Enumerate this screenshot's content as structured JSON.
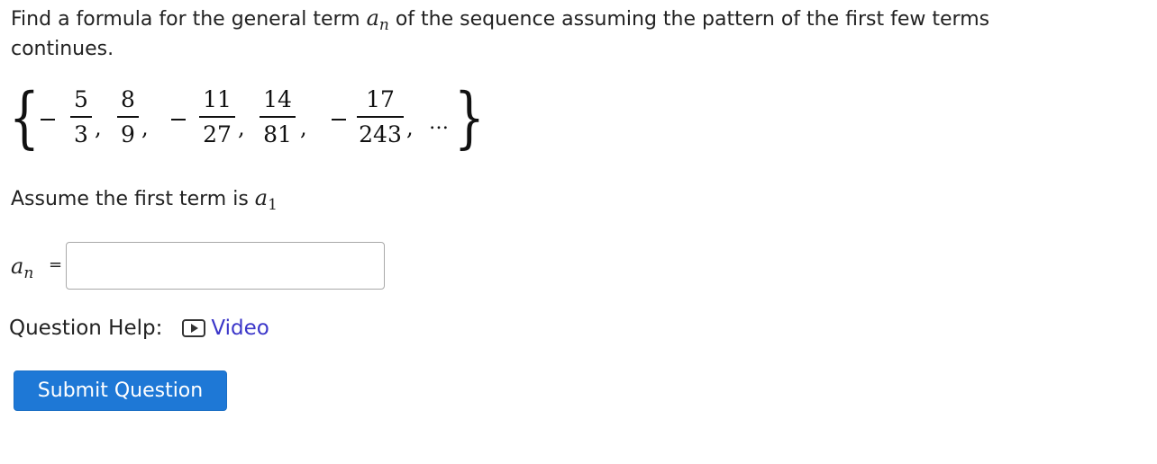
{
  "question": {
    "prompt_before": "Find a formula for the general term ",
    "prompt_var": "a",
    "prompt_sub": "n",
    "prompt_after": " of the sequence assuming the pattern of the first few terms continues.",
    "sequence": {
      "terms": [
        {
          "sign": "−",
          "numerator": "5",
          "denominator": "3"
        },
        {
          "sign": "",
          "numerator": "8",
          "denominator": "9"
        },
        {
          "sign": "−",
          "numerator": "11",
          "denominator": "27"
        },
        {
          "sign": "",
          "numerator": "14",
          "denominator": "81"
        },
        {
          "sign": "−",
          "numerator": "17",
          "denominator": "243"
        }
      ],
      "comma": ",",
      "ellipsis": "…",
      "open_brace": "{",
      "close_brace": "}"
    },
    "assume_text": "Assume the first term is ",
    "assume_var": "a",
    "assume_sub": "1"
  },
  "answer": {
    "label_var": "a",
    "label_sub": "n",
    "equals": "=",
    "value": "",
    "placeholder": ""
  },
  "help": {
    "label": "Question Help:",
    "video_label": "Video",
    "video_icon": "play-video-icon"
  },
  "submit": {
    "label": "Submit Question",
    "color": "#1e78d6"
  },
  "colors": {
    "link": "#3b36c9",
    "text": "#222222",
    "input_border": "#a9a9a9"
  }
}
